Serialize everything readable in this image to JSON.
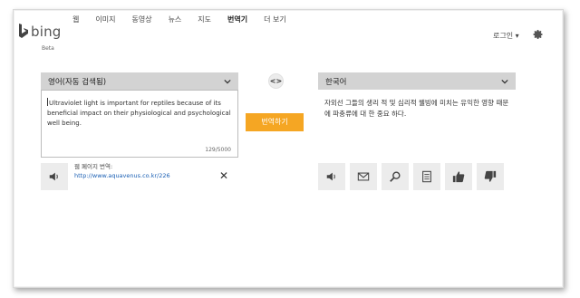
{
  "nav": {
    "items": [
      "웹",
      "이미지",
      "동영상",
      "뉴스",
      "지도",
      "번역기",
      "더 보기"
    ],
    "active_index": 5
  },
  "logo": {
    "word": "bing",
    "beta": "Beta"
  },
  "header": {
    "login": "로그인 ▾"
  },
  "source": {
    "language": "영어(자동 검색됨)",
    "text": "Ultraviolet light is important for reptiles because of its beneficial impact on their physiological and psychological well being.",
    "char_count": "129/5000",
    "webpage_label": "웹 페이지 번역:",
    "webpage_url": "http://www.aquavenus.co.kr/226"
  },
  "target": {
    "language": "한국어",
    "text": "자외선 그들의 생리 적 및 심리적 웰빙에 미치는 유익한 영향 때문에 파충류에 대 한 중요 하다."
  },
  "translate_button": "번역하기",
  "swap_label": "<>",
  "close_label": "✕",
  "icons": {
    "source": [
      "speaker-icon"
    ],
    "target": [
      "speaker-icon",
      "mail-icon",
      "search-icon",
      "document-icon",
      "thumbs-up-icon",
      "thumbs-down-icon"
    ]
  },
  "colors": {
    "accent": "#f5a623",
    "link": "#1a5fb4",
    "header_bar": "#d3d3d3",
    "icon_button": "#ececec"
  }
}
